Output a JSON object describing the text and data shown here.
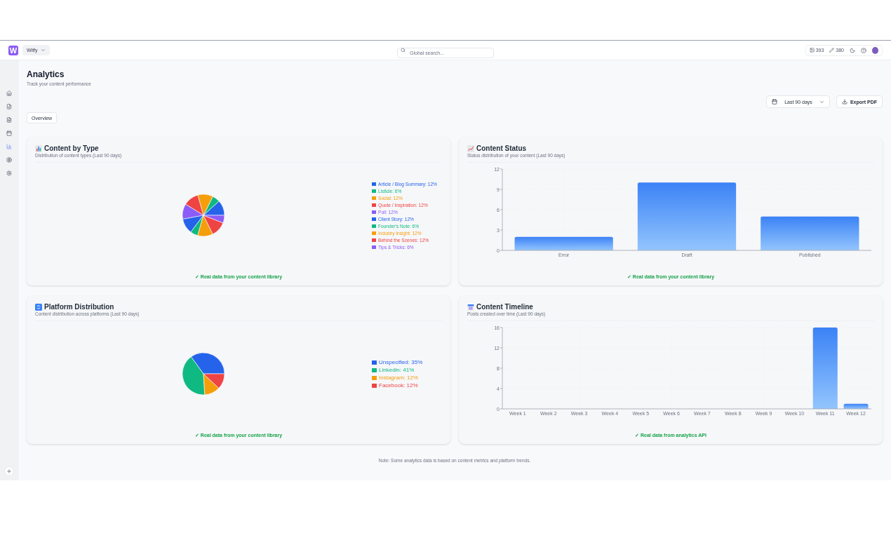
{
  "topbar": {
    "logo": "W",
    "workspace": "Witfy",
    "search": {
      "placeholder": "Global search..."
    },
    "stats": [
      {
        "kind": "images",
        "value": "393"
      },
      {
        "kind": "edits",
        "value": "380"
      }
    ]
  },
  "sidebar": {
    "items": [
      {
        "kind": "home",
        "selected": false
      },
      {
        "kind": "file-plus",
        "selected": false
      },
      {
        "kind": "file-text",
        "selected": false
      },
      {
        "kind": "calendar",
        "selected": false
      },
      {
        "kind": "chart",
        "selected": true
      },
      {
        "kind": "coin",
        "selected": false
      },
      {
        "kind": "settings",
        "selected": false
      }
    ]
  },
  "header": {
    "title": "Analytics",
    "subtitle": "Track your content performance"
  },
  "controls": {
    "range": "Last 90 days",
    "export": "Export PDF"
  },
  "tabs": [
    {
      "label": "Overview",
      "selected": true
    }
  ],
  "cards": [
    {
      "title": "Content by Type",
      "subtitle": "Distribution of content types (Last 90 days)",
      "chart_data": {
        "type": "pie",
        "values": [
          12,
          6,
          12,
          12,
          12,
          12,
          6,
          12,
          12,
          6
        ]
      },
      "legend": [
        {
          "label": "Article / Blog Summary: 12%",
          "color": "#2563eb"
        },
        {
          "label": "Listicle: 6%",
          "color": "#10b981"
        },
        {
          "label": "Social: 12%",
          "color": "#f59e0b"
        },
        {
          "label": "Quote / Inspiration: 12%",
          "color": "#ef4444"
        },
        {
          "label": "Poll: 12%",
          "color": "#8b5cf6"
        },
        {
          "label": "Client Story: 12%",
          "color": "#2563eb"
        },
        {
          "label": "Founder's Note: 6%",
          "color": "#10b981"
        },
        {
          "label": "Industry Insight: 12%",
          "color": "#f59e0b"
        },
        {
          "label": "Behind the Scenes: 12%",
          "color": "#ef4444"
        },
        {
          "label": "Tips & Tricks: 6%",
          "color": "#8b5cf6"
        }
      ],
      "footnote": "✓ Real data from your content library"
    },
    {
      "title": "Content Status",
      "subtitle": "Status distribution of your content (Last 90 days)",
      "chart_data": {
        "type": "bar",
        "categories": [
          "Error",
          "Draft",
          "Published"
        ],
        "values": [
          2,
          10,
          5
        ],
        "ylim": [
          0,
          12
        ],
        "yticks": [
          0,
          3,
          6,
          9,
          12
        ]
      },
      "footnote": "✓ Real data from your content library"
    },
    {
      "title": "Platform Distribution",
      "subtitle": "Content distribution across platforms (Last 90 days)",
      "chart_data": {
        "type": "pie",
        "values": [
          35,
          41,
          12,
          12
        ]
      },
      "legend": [
        {
          "label": "Unspecified: 35%",
          "color": "#2563eb"
        },
        {
          "label": "Linkedin: 41%",
          "color": "#10b981"
        },
        {
          "label": "Instagram: 12%",
          "color": "#f59e0b"
        },
        {
          "label": "Facebook: 12%",
          "color": "#ef4444"
        }
      ],
      "footnote": "✓ Real data from your content library"
    },
    {
      "title": "Content Timeline",
      "subtitle": "Posts created over time (Last 90 days)",
      "chart_data": {
        "type": "bar",
        "categories": [
          "Week 1",
          "Week 2",
          "Week 3",
          "Week 4",
          "Week 5",
          "Week 6",
          "Week 7",
          "Week 8",
          "Week 9",
          "Week 10",
          "Week 11",
          "Week 12"
        ],
        "values": [
          0,
          0,
          0,
          0,
          0,
          0,
          0,
          0,
          0,
          0,
          16,
          1
        ],
        "ylim": [
          0,
          16
        ],
        "yticks": [
          0,
          4,
          8,
          12,
          16
        ]
      },
      "footnote": "✓ Real data from analytics API"
    }
  ],
  "note": "Note: Some analytics data is based on content metrics and platform trends."
}
